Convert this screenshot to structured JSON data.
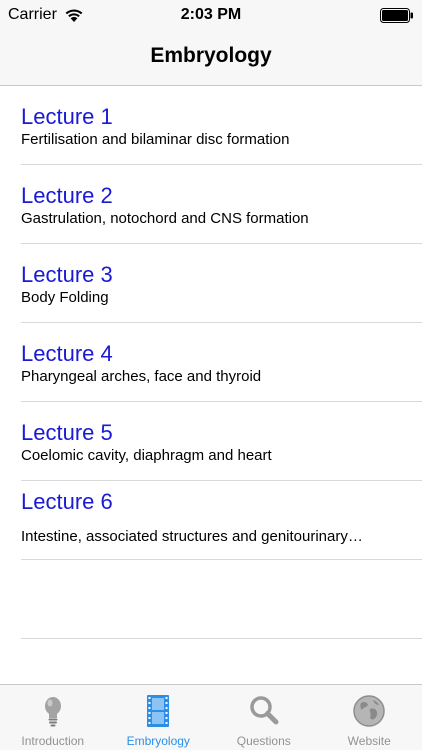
{
  "status_bar": {
    "carrier": "Carrier",
    "time": "2:03 PM"
  },
  "nav": {
    "title": "Embryology"
  },
  "lectures": [
    {
      "title": "Lecture 1",
      "subtitle": "Fertilisation and bilaminar disc formation"
    },
    {
      "title": "Lecture 2",
      "subtitle": "Gastrulation, notochord and CNS formation"
    },
    {
      "title": "Lecture 3",
      "subtitle": "Body Folding"
    },
    {
      "title": "Lecture 4",
      "subtitle": "Pharyngeal arches, face and thyroid"
    },
    {
      "title": "Lecture 5",
      "subtitle": "Coelomic cavity, diaphragm and heart"
    },
    {
      "title": "Lecture 6",
      "subtitle": "Intestine, associated structures and genitourinary…"
    }
  ],
  "tabs": [
    {
      "label": "Introduction",
      "icon": "lightbulb-icon"
    },
    {
      "label": "Embryology",
      "icon": "film-icon"
    },
    {
      "label": "Questions",
      "icon": "magnifier-icon"
    },
    {
      "label": "Website",
      "icon": "globe-icon"
    }
  ],
  "colors": {
    "link_blue": "#1a1ad6",
    "tab_active": "#2b8fe8",
    "tab_inactive": "#929292"
  }
}
